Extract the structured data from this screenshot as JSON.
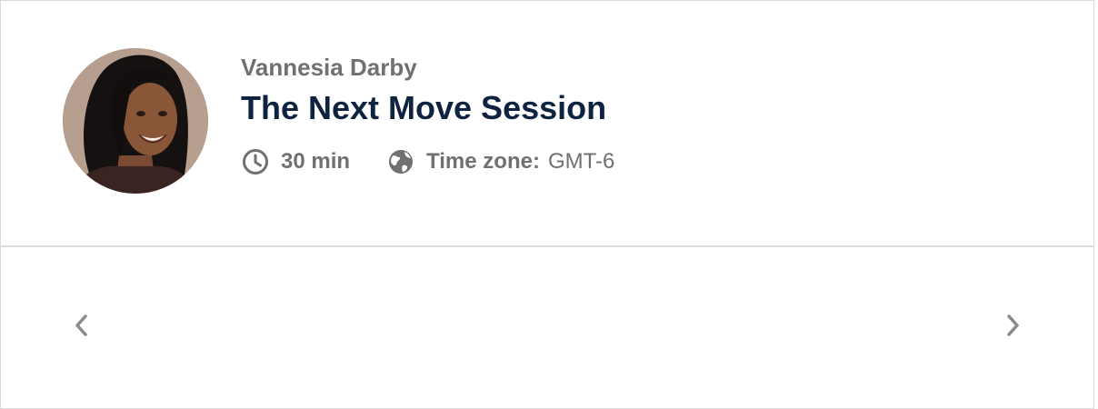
{
  "host": {
    "name": "Vannesia Darby",
    "avatar_icon": "host-avatar"
  },
  "event": {
    "title": "The Next Move Session",
    "duration": "30 min",
    "timezone_label": "Time zone:",
    "timezone_value": "GMT-6"
  },
  "icons": {
    "duration": "clock-icon",
    "timezone": "globe-icon",
    "previous": "chevron-left-icon",
    "next": "chevron-right-icon"
  },
  "colors": {
    "title": "#0e2340",
    "muted_text": "#707070",
    "border": "#d9d9d9",
    "arrow": "#8a8a8a"
  }
}
